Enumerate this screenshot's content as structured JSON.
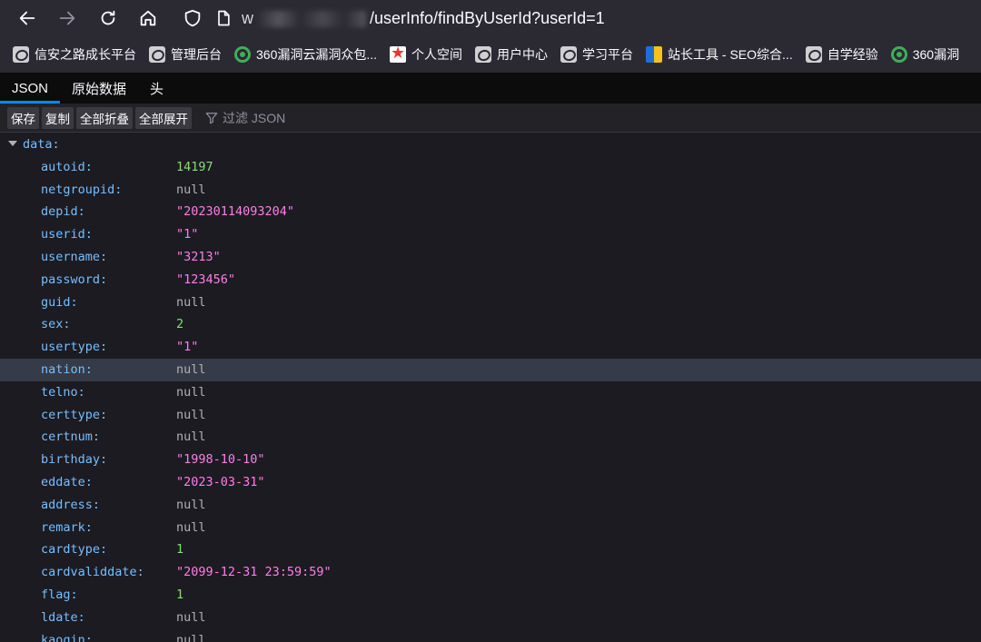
{
  "address_bar": {
    "url_prefix": "w",
    "url_path": "/userInfo/findByUserId?userId=1"
  },
  "bookmarks": [
    {
      "label": "信安之路成长平台",
      "icon": "globe-icon"
    },
    {
      "label": "管理后台",
      "icon": "globe-icon"
    },
    {
      "label": "360漏洞云漏洞众包...",
      "icon": "360-icon"
    },
    {
      "label": "个人空间",
      "icon": "star-icon"
    },
    {
      "label": "用户中心",
      "icon": "globe-icon"
    },
    {
      "label": "学习平台",
      "icon": "globe-icon"
    },
    {
      "label": "站长工具 - SEO综合...",
      "icon": "book-icon"
    },
    {
      "label": "自学经验",
      "icon": "globe-icon"
    },
    {
      "label": "360漏洞",
      "icon": "360-icon"
    }
  ],
  "tabs": [
    "JSON",
    "原始数据",
    "头"
  ],
  "toolbar": {
    "save": "保存",
    "copy": "复制",
    "collapse_all": "全部折叠",
    "expand_all": "全部展开",
    "filter_placeholder": "过滤 JSON"
  },
  "tree": {
    "root_key": "data:",
    "rows": [
      {
        "key": "autoid:",
        "value": "14197",
        "type": "number"
      },
      {
        "key": "netgroupid:",
        "value": "null",
        "type": "null"
      },
      {
        "key": "depid:",
        "value": "\"20230114093204\"",
        "type": "string"
      },
      {
        "key": "userid:",
        "value": "\"1\"",
        "type": "string"
      },
      {
        "key": "username:",
        "value": "\"3213\"",
        "type": "string"
      },
      {
        "key": "password:",
        "value": "\"123456\"",
        "type": "string"
      },
      {
        "key": "guid:",
        "value": "null",
        "type": "null"
      },
      {
        "key": "sex:",
        "value": "2",
        "type": "number"
      },
      {
        "key": "usertype:",
        "value": "\"1\"",
        "type": "string"
      },
      {
        "key": "nation:",
        "value": "null",
        "type": "null",
        "highlighted": true
      },
      {
        "key": "telno:",
        "value": "null",
        "type": "null"
      },
      {
        "key": "certtype:",
        "value": "null",
        "type": "null"
      },
      {
        "key": "certnum:",
        "value": "null",
        "type": "null"
      },
      {
        "key": "birthday:",
        "value": "\"1998-10-10\"",
        "type": "string"
      },
      {
        "key": "eddate:",
        "value": "\"2023-03-31\"",
        "type": "string"
      },
      {
        "key": "address:",
        "value": "null",
        "type": "null"
      },
      {
        "key": "remark:",
        "value": "null",
        "type": "null"
      },
      {
        "key": "cardtype:",
        "value": "1",
        "type": "number"
      },
      {
        "key": "cardvaliddate:",
        "value": "\"2099-12-31 23:59:59\"",
        "type": "string"
      },
      {
        "key": "flag:",
        "value": "1",
        "type": "number"
      },
      {
        "key": "ldate:",
        "value": "null",
        "type": "null"
      },
      {
        "key": "kaoqin:",
        "value": "null",
        "type": "null"
      }
    ]
  },
  "colors": {
    "key": "#75bfff",
    "number": "#86de74",
    "string": "#ff7de9",
    "null": "#b1b1b3",
    "accent": "#0a84ff"
  }
}
